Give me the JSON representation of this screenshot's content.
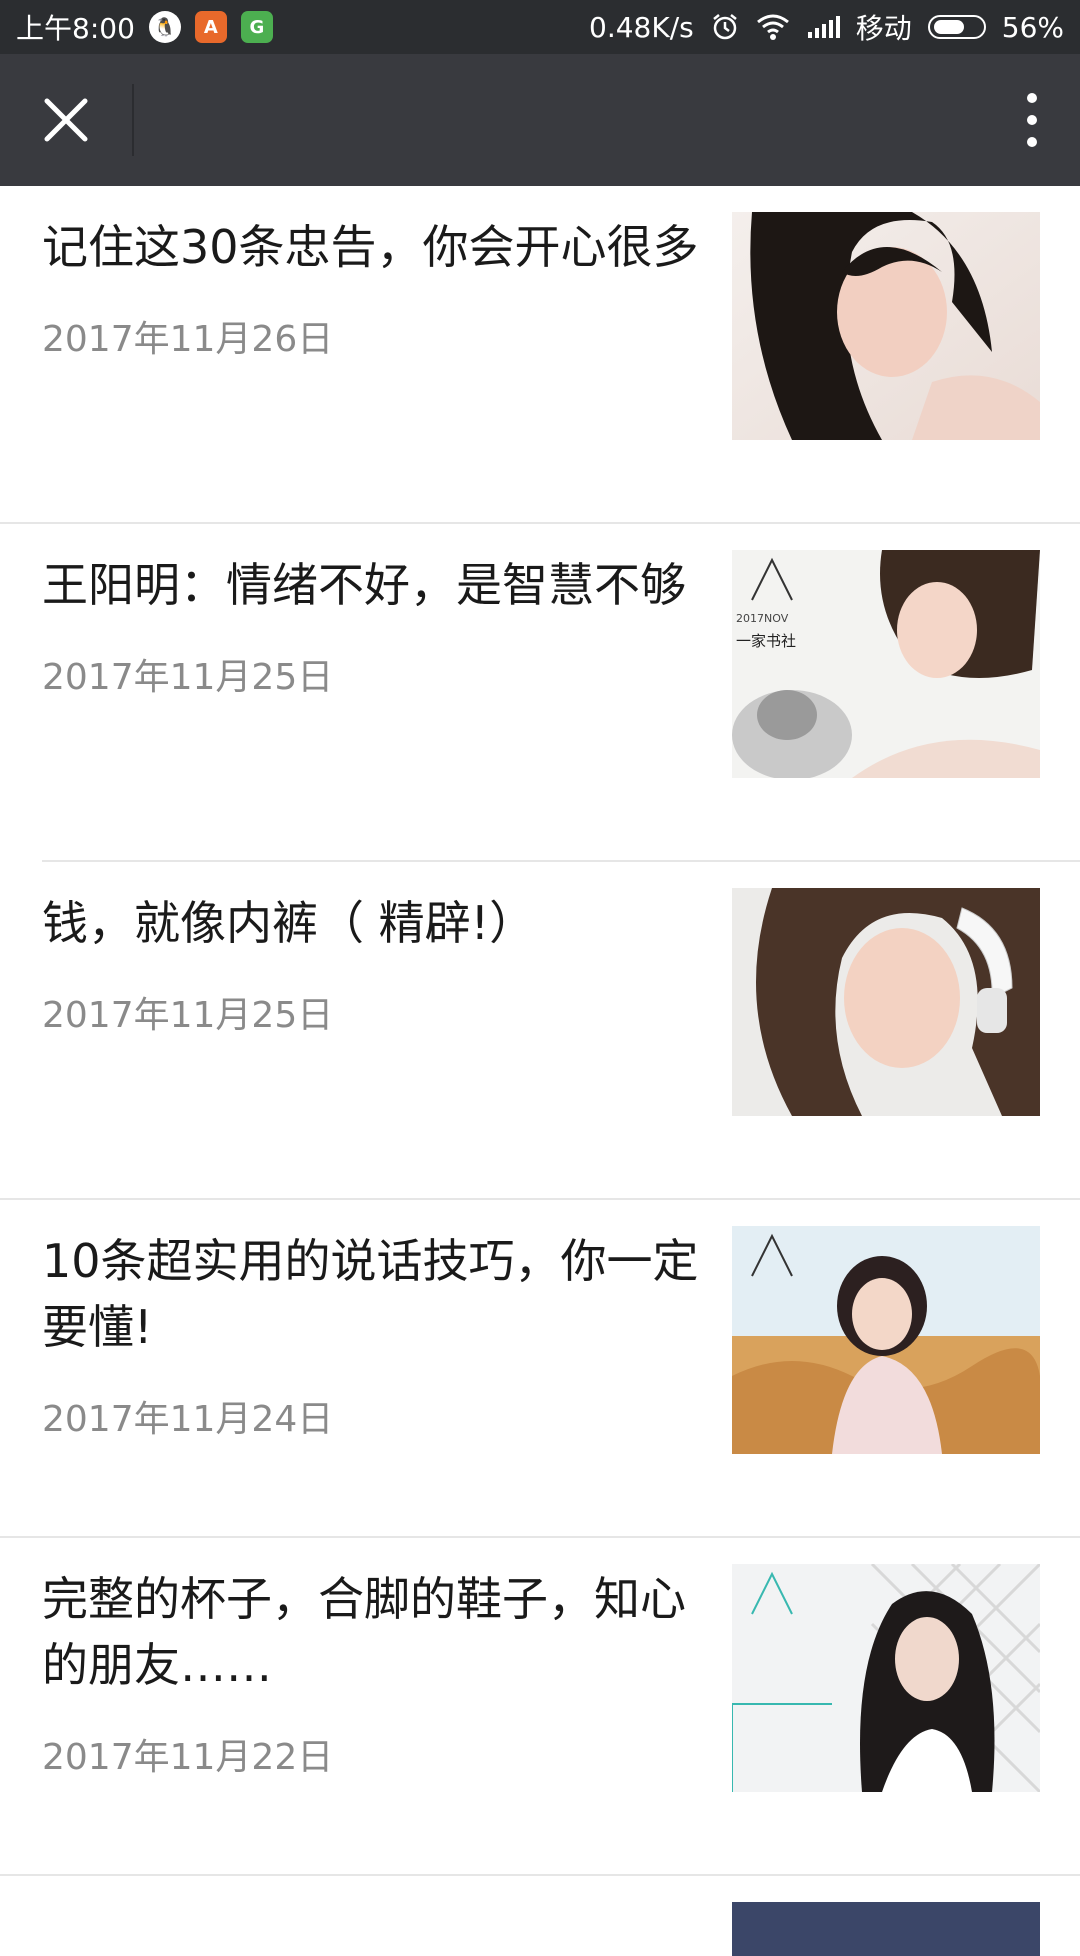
{
  "status_bar": {
    "time": "上午8:00",
    "speed": "0.48K/s",
    "carrier": "移动",
    "battery": "56%",
    "qq_icon_char": "🐧",
    "orange_icon_char": "A",
    "green_icon_char": "G"
  },
  "articles": [
    {
      "title": "记住这30条忠告，你会开心很多",
      "date": "2017年11月26日"
    },
    {
      "title": "王阳明：情绪不好，是智慧不够",
      "date": "2017年11月25日"
    },
    {
      "title": "钱，就像内裤（ 精辟!）",
      "date": "2017年11月25日"
    },
    {
      "title": "10条超实用的说话技巧，你一定要懂!",
      "date": "2017年11月24日"
    },
    {
      "title": "完整的杯子，合脚的鞋子，知心的朋友……",
      "date": "2017年11月22日"
    }
  ],
  "thumb_texts": {
    "watermark_year": "2017NOV",
    "watermark_brand": "一家书社"
  },
  "colors": {
    "status_bar": "#2b2d30",
    "title_bar": "#393a3f",
    "title_text": "#1a1a1a",
    "date_text": "#8a8a8a"
  }
}
